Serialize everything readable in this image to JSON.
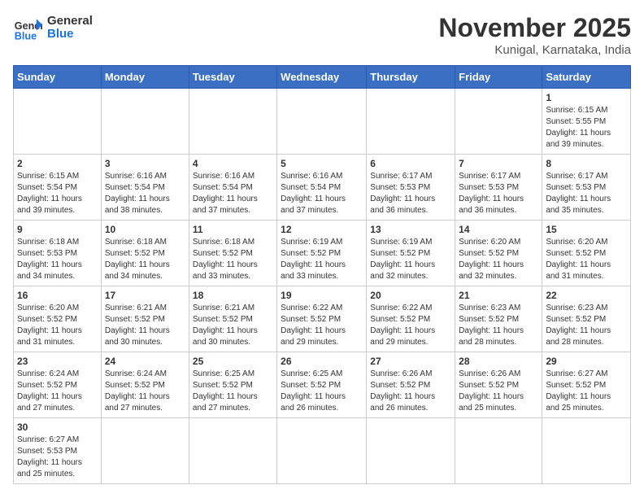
{
  "logo": {
    "general": "General",
    "blue": "Blue"
  },
  "title": "November 2025",
  "location": "Kunigal, Karnataka, India",
  "weekdays": [
    "Sunday",
    "Monday",
    "Tuesday",
    "Wednesday",
    "Thursday",
    "Friday",
    "Saturday"
  ],
  "weeks": [
    [
      {
        "day": "",
        "info": ""
      },
      {
        "day": "",
        "info": ""
      },
      {
        "day": "",
        "info": ""
      },
      {
        "day": "",
        "info": ""
      },
      {
        "day": "",
        "info": ""
      },
      {
        "day": "",
        "info": ""
      },
      {
        "day": "1",
        "info": "Sunrise: 6:15 AM\nSunset: 5:55 PM\nDaylight: 11 hours\nand 39 minutes."
      }
    ],
    [
      {
        "day": "2",
        "info": "Sunrise: 6:15 AM\nSunset: 5:54 PM\nDaylight: 11 hours\nand 39 minutes."
      },
      {
        "day": "3",
        "info": "Sunrise: 6:16 AM\nSunset: 5:54 PM\nDaylight: 11 hours\nand 38 minutes."
      },
      {
        "day": "4",
        "info": "Sunrise: 6:16 AM\nSunset: 5:54 PM\nDaylight: 11 hours\nand 37 minutes."
      },
      {
        "day": "5",
        "info": "Sunrise: 6:16 AM\nSunset: 5:54 PM\nDaylight: 11 hours\nand 37 minutes."
      },
      {
        "day": "6",
        "info": "Sunrise: 6:17 AM\nSunset: 5:53 PM\nDaylight: 11 hours\nand 36 minutes."
      },
      {
        "day": "7",
        "info": "Sunrise: 6:17 AM\nSunset: 5:53 PM\nDaylight: 11 hours\nand 36 minutes."
      },
      {
        "day": "8",
        "info": "Sunrise: 6:17 AM\nSunset: 5:53 PM\nDaylight: 11 hours\nand 35 minutes."
      }
    ],
    [
      {
        "day": "9",
        "info": "Sunrise: 6:18 AM\nSunset: 5:53 PM\nDaylight: 11 hours\nand 34 minutes."
      },
      {
        "day": "10",
        "info": "Sunrise: 6:18 AM\nSunset: 5:52 PM\nDaylight: 11 hours\nand 34 minutes."
      },
      {
        "day": "11",
        "info": "Sunrise: 6:18 AM\nSunset: 5:52 PM\nDaylight: 11 hours\nand 33 minutes."
      },
      {
        "day": "12",
        "info": "Sunrise: 6:19 AM\nSunset: 5:52 PM\nDaylight: 11 hours\nand 33 minutes."
      },
      {
        "day": "13",
        "info": "Sunrise: 6:19 AM\nSunset: 5:52 PM\nDaylight: 11 hours\nand 32 minutes."
      },
      {
        "day": "14",
        "info": "Sunrise: 6:20 AM\nSunset: 5:52 PM\nDaylight: 11 hours\nand 32 minutes."
      },
      {
        "day": "15",
        "info": "Sunrise: 6:20 AM\nSunset: 5:52 PM\nDaylight: 11 hours\nand 31 minutes."
      }
    ],
    [
      {
        "day": "16",
        "info": "Sunrise: 6:20 AM\nSunset: 5:52 PM\nDaylight: 11 hours\nand 31 minutes."
      },
      {
        "day": "17",
        "info": "Sunrise: 6:21 AM\nSunset: 5:52 PM\nDaylight: 11 hours\nand 30 minutes."
      },
      {
        "day": "18",
        "info": "Sunrise: 6:21 AM\nSunset: 5:52 PM\nDaylight: 11 hours\nand 30 minutes."
      },
      {
        "day": "19",
        "info": "Sunrise: 6:22 AM\nSunset: 5:52 PM\nDaylight: 11 hours\nand 29 minutes."
      },
      {
        "day": "20",
        "info": "Sunrise: 6:22 AM\nSunset: 5:52 PM\nDaylight: 11 hours\nand 29 minutes."
      },
      {
        "day": "21",
        "info": "Sunrise: 6:23 AM\nSunset: 5:52 PM\nDaylight: 11 hours\nand 28 minutes."
      },
      {
        "day": "22",
        "info": "Sunrise: 6:23 AM\nSunset: 5:52 PM\nDaylight: 11 hours\nand 28 minutes."
      }
    ],
    [
      {
        "day": "23",
        "info": "Sunrise: 6:24 AM\nSunset: 5:52 PM\nDaylight: 11 hours\nand 27 minutes."
      },
      {
        "day": "24",
        "info": "Sunrise: 6:24 AM\nSunset: 5:52 PM\nDaylight: 11 hours\nand 27 minutes."
      },
      {
        "day": "25",
        "info": "Sunrise: 6:25 AM\nSunset: 5:52 PM\nDaylight: 11 hours\nand 27 minutes."
      },
      {
        "day": "26",
        "info": "Sunrise: 6:25 AM\nSunset: 5:52 PM\nDaylight: 11 hours\nand 26 minutes."
      },
      {
        "day": "27",
        "info": "Sunrise: 6:26 AM\nSunset: 5:52 PM\nDaylight: 11 hours\nand 26 minutes."
      },
      {
        "day": "28",
        "info": "Sunrise: 6:26 AM\nSunset: 5:52 PM\nDaylight: 11 hours\nand 25 minutes."
      },
      {
        "day": "29",
        "info": "Sunrise: 6:27 AM\nSunset: 5:52 PM\nDaylight: 11 hours\nand 25 minutes."
      }
    ],
    [
      {
        "day": "30",
        "info": "Sunrise: 6:27 AM\nSunset: 5:53 PM\nDaylight: 11 hours\nand 25 minutes."
      },
      {
        "day": "",
        "info": ""
      },
      {
        "day": "",
        "info": ""
      },
      {
        "day": "",
        "info": ""
      },
      {
        "day": "",
        "info": ""
      },
      {
        "day": "",
        "info": ""
      },
      {
        "day": "",
        "info": ""
      }
    ]
  ]
}
